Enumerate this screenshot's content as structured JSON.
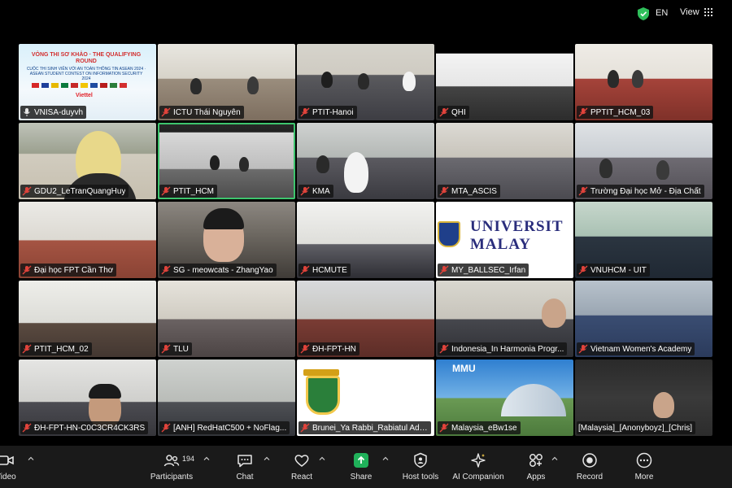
{
  "topbar": {
    "language": "EN",
    "view_label": "View"
  },
  "tiles": [
    {
      "name": "VNISA-duyvh",
      "banner_title": "VÒNG THI SƠ KHẢO · THE QUALIFYING ROUND",
      "banner_sub": "CUỘC THI SINH VIÊN VỚI AN TOÀN THÔNG TIN ASEAN 2024 · ASEAN STUDENT CONTEST ON INFORMATION SECURITY 2024",
      "banner_note": "Viettel"
    },
    {
      "name": "ICTU Thái Nguyên"
    },
    {
      "name": "PTIT-Hanoi"
    },
    {
      "name": "QHI"
    },
    {
      "name": "PPTIT_HCM_03"
    },
    {
      "name": "GDU2_LeTranQuangHuy"
    },
    {
      "name": "PTIT_HCM"
    },
    {
      "name": "KMA"
    },
    {
      "name": "MTA_ASCIS"
    },
    {
      "name": "Trường Đại học Mở - Địa Chất"
    },
    {
      "name": "Đại học FPT Cần Thơ"
    },
    {
      "name": "SG - meowcats - ZhangYao"
    },
    {
      "name": "HCMUTE"
    },
    {
      "name": "MY_BALLSEC_Irfan",
      "logo_line1": "UNIVERSIT",
      "logo_line2": "MALAY"
    },
    {
      "name": "VNUHCM - UIT"
    },
    {
      "name": "PTIT_HCM_02"
    },
    {
      "name": "TLU"
    },
    {
      "name": "ĐH-FPT-HN"
    },
    {
      "name": "Indonesia_In Harmonia Progr..."
    },
    {
      "name": "Vietnam Women's Academy"
    },
    {
      "name": "ĐH-FPT-HN-C0C3CR4CK3RS"
    },
    {
      "name": "[ANH] RedHatC500 + NoFlag..."
    },
    {
      "name": "Brunei_Ya Rabbi_Rabiatul Ada..."
    },
    {
      "name": "Malaysia_eBw1se",
      "logo_text": "MMU"
    },
    {
      "name": "[Malaysia]_[Anonyboyz]_[Chris]"
    }
  ],
  "toolbar": {
    "video_label": "Video",
    "participants_label": "Participants",
    "participants_count": "194",
    "chat_label": "Chat",
    "react_label": "React",
    "share_label": "Share",
    "host_tools_label": "Host tools",
    "ai_companion_label": "AI Companion",
    "apps_label": "Apps",
    "record_label": "Record",
    "more_label": "More"
  },
  "colors": {
    "active_speaker": "#3ec46d",
    "share_green": "#20b15a",
    "mute_red": "#e0433b",
    "toolbar_bg": "#1a1a1a"
  }
}
